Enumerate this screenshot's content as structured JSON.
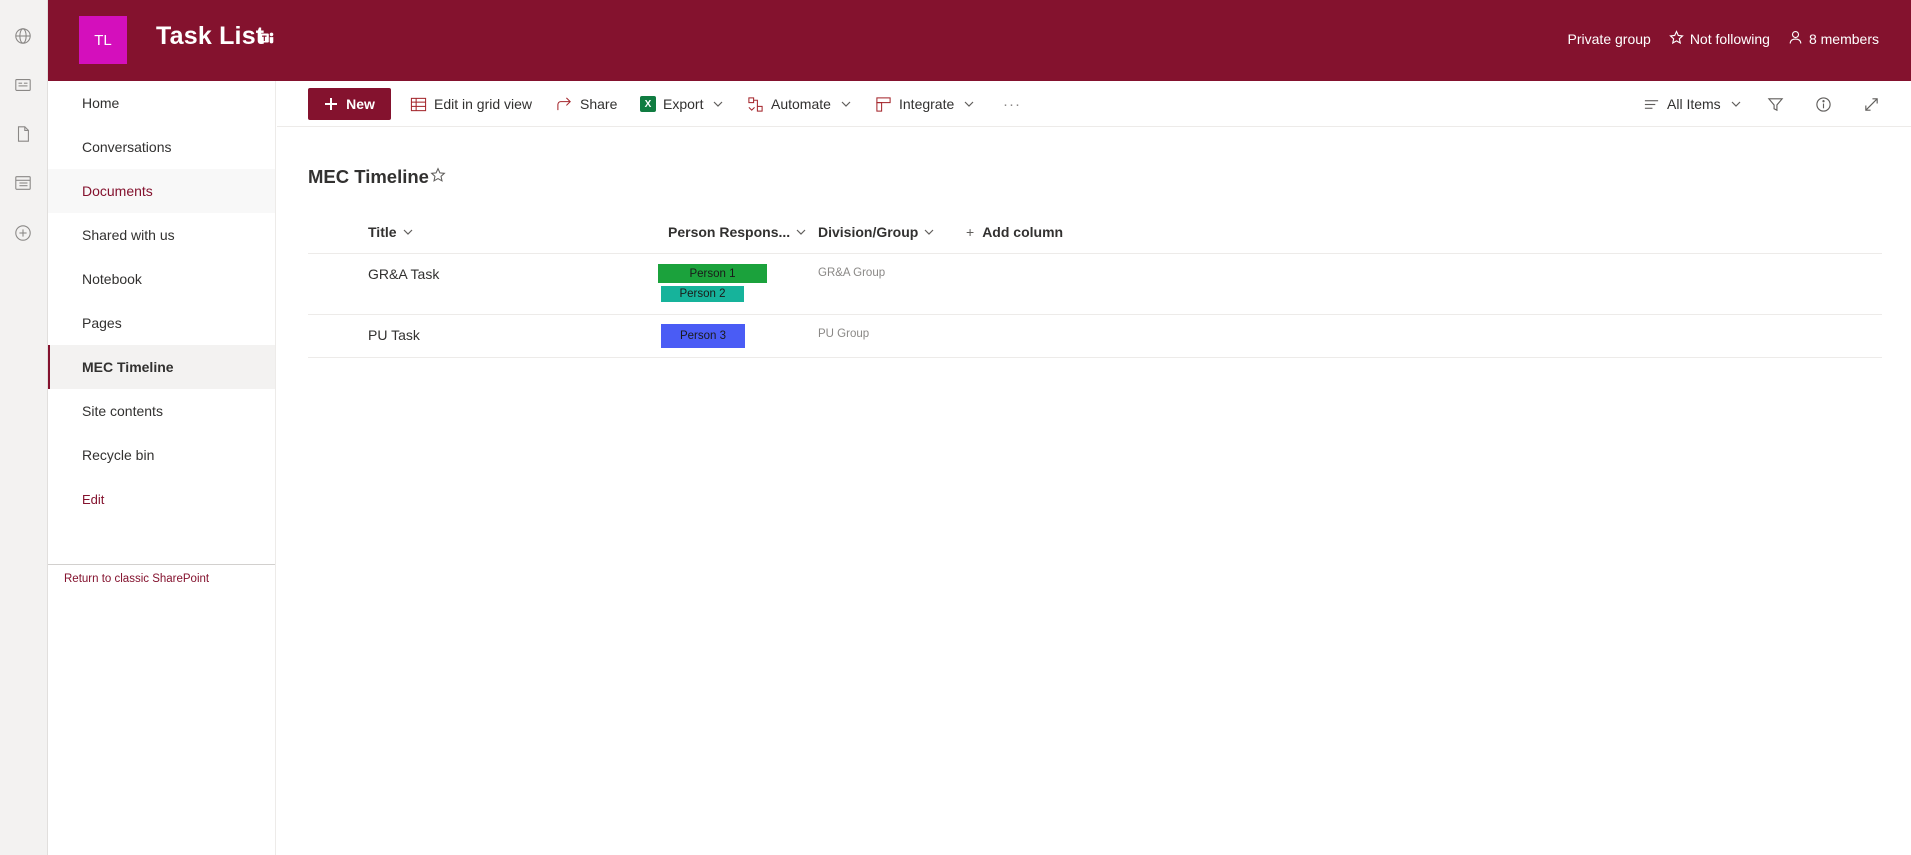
{
  "rail": {
    "icons": [
      "globe-icon",
      "news-icon",
      "document-icon",
      "list-icon",
      "add-circle-icon"
    ]
  },
  "header": {
    "logo_initials": "TL",
    "site_title": "Task List",
    "privacy": "Private group",
    "follow_label": "Not following",
    "members_label": "8 members",
    "bg_color": "#84122e",
    "logo_color": "#d40fbc"
  },
  "nav": {
    "items": [
      {
        "label": "Home"
      },
      {
        "label": "Conversations"
      },
      {
        "label": "Documents"
      },
      {
        "label": "Shared with us"
      },
      {
        "label": "Notebook"
      },
      {
        "label": "Pages"
      },
      {
        "label": "MEC Timeline"
      },
      {
        "label": "Site contents"
      },
      {
        "label": "Recycle bin"
      },
      {
        "label": "Edit"
      }
    ],
    "selected": "MEC Timeline",
    "classic_link": "Return to classic SharePoint"
  },
  "commands": {
    "new_label": "New",
    "edit_grid_label": "Edit in grid view",
    "share_label": "Share",
    "export_label": "Export",
    "automate_label": "Automate",
    "integrate_label": "Integrate",
    "more_label": "···",
    "view_label": "All Items"
  },
  "list": {
    "title": "MEC Timeline",
    "columns": {
      "title": "Title",
      "person": "Person Respons...",
      "division": "Division/Group",
      "add_column": "Add column"
    },
    "rows": [
      {
        "title": "GR&A Task",
        "persons": [
          {
            "name": "Person 1",
            "color": "#1ba23c"
          },
          {
            "name": "Person 2",
            "color": "#16b39b"
          }
        ],
        "division": "GR&A Group"
      },
      {
        "title": "PU Task",
        "persons": [
          {
            "name": "Person 3",
            "color": "#4a5cf5"
          }
        ],
        "division": "PU Group"
      }
    ]
  }
}
